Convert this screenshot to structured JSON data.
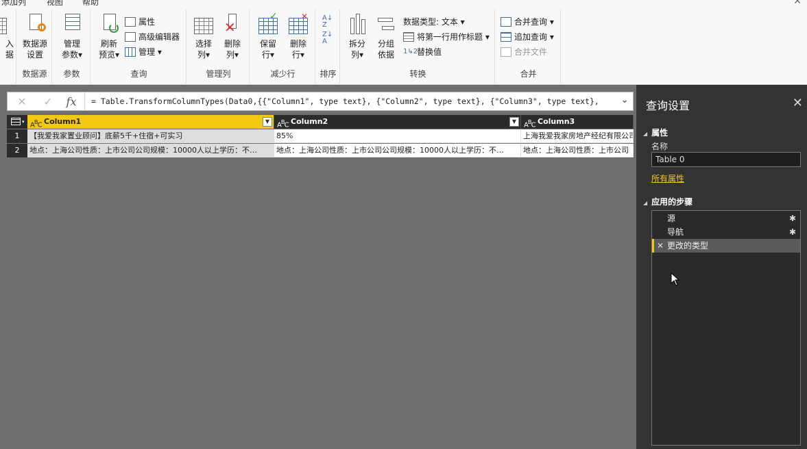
{
  "menu_tabs": [
    "添加列",
    "视图",
    "帮助"
  ],
  "ribbon": {
    "left_cut_btn": {
      "line1": "入",
      "line2": "据"
    },
    "groups": {
      "datasource": {
        "label": "数据源",
        "btn": {
          "line1": "数据源",
          "line2": "设置"
        }
      },
      "params": {
        "label": "参数",
        "btn": {
          "line1": "管理",
          "line2": "参数▾"
        }
      },
      "query": {
        "label": "查询",
        "btn": {
          "line1": "刷新",
          "line2": "预览▾"
        },
        "small": [
          "属性",
          "高级编辑器",
          "管理 ▾"
        ]
      },
      "manage_cols": {
        "label": "管理列",
        "btn1": {
          "line1": "选择",
          "line2": "列▾"
        },
        "btn2": {
          "line1": "删除",
          "line2": "列▾"
        }
      },
      "reduce_rows": {
        "label": "减少行",
        "btn1": {
          "line1": "保留",
          "line2": "行▾"
        },
        "btn2": {
          "line1": "删除",
          "line2": "行▾"
        }
      },
      "sort": {
        "label": "排序"
      },
      "transform": {
        "label": "转换",
        "btn1": {
          "line1": "拆分",
          "line2": "列▾"
        },
        "btn2": {
          "line1": "分组",
          "line2": "依据"
        },
        "small": [
          "数据类型: 文本 ▾",
          "将第一行用作标题 ▾",
          "替换值"
        ]
      },
      "combine": {
        "label": "合并",
        "small": [
          "合并查询 ▾",
          "追加查询 ▾",
          "合并文件"
        ]
      }
    }
  },
  "formula": {
    "cancel": "✕",
    "confirm": "✓",
    "fx": "fx",
    "text": "= Table.TransformColumnTypes(Data0,{{\"Column1\", type text}, {\"Column2\", type text}, {\"Column3\", type text},",
    "chevron": "⌄"
  },
  "table": {
    "columns": [
      "Column1",
      "Column2",
      "Column3"
    ],
    "type_label": "ABC",
    "rows": [
      {
        "num": "1",
        "cells": [
          "【我爱我家置业顾问】底薪5千+住宿+可实习",
          "85%",
          "上海我爱我家房地产经纪有限公司"
        ]
      },
      {
        "num": "2",
        "cells": [
          "地点：上海公司性质：上市公司公司规模：10000人以上学历：不…",
          "地点：上海公司性质：上市公司公司规模：10000人以上学历：不…",
          "地点：上海公司性质：上市公司"
        ]
      }
    ]
  },
  "pane": {
    "title": "查询设置",
    "close": "✕",
    "props_section": "属性",
    "name_label": "名称",
    "name_value": "Table 0",
    "all_props": "所有属性",
    "steps_section": "应用的步骤",
    "steps": [
      {
        "label": "源",
        "gear": true
      },
      {
        "label": "导航",
        "gear": true
      },
      {
        "label": "更改的类型",
        "gear": false
      }
    ]
  },
  "colors": {
    "accent": "#f2c811",
    "pane_bg": "#333333",
    "canvas_bg": "#6e6e6e"
  }
}
